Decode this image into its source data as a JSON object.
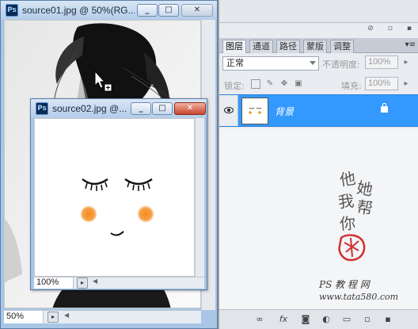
{
  "window1": {
    "title": "source01.jpg @ 50%(RG...",
    "ps_badge": "Ps",
    "zoom": "50%",
    "controls": {
      "minimize": "_",
      "maximize": "□",
      "close": "✕"
    }
  },
  "window2": {
    "title": "source02.jpg @...",
    "ps_badge": "Ps",
    "zoom": "100%",
    "controls": {
      "minimize": "_",
      "maximize": "□",
      "close": "✕"
    }
  },
  "layers_panel": {
    "tabs": [
      {
        "label": "图层",
        "active": true
      },
      {
        "label": "通道",
        "active": false
      },
      {
        "label": "路径",
        "active": false
      },
      {
        "label": "蒙版",
        "active": false
      },
      {
        "label": "调整",
        "active": false
      }
    ],
    "blend_mode": "正常",
    "opacity_label": "不透明度:",
    "opacity_value": "100%",
    "lock_label": "锁定:",
    "fill_label": "填充:",
    "fill_value": "100%",
    "layers": [
      {
        "name": "背景",
        "visible": true,
        "locked": true,
        "selected": true
      }
    ],
    "accent_color": "#3399ff"
  },
  "watermark": {
    "line1": "他",
    "line2": "她",
    "line3": "我",
    "line4": "帮",
    "line5": "你",
    "site_cn": "PS 教 程 网",
    "site_url": "www.tata580.com"
  },
  "icons": {
    "link": "link-icon",
    "fx": "fx",
    "mask": "mask-icon",
    "adjust": "adjustment-icon",
    "group": "folder-icon",
    "new": "new-layer-icon",
    "trash": "trash-icon"
  }
}
